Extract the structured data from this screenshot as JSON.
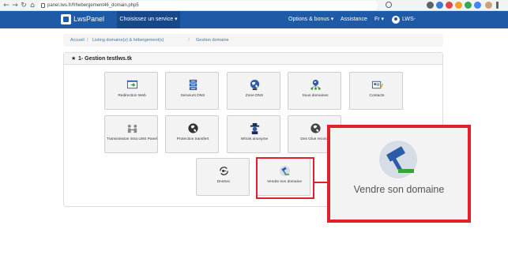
{
  "browser": {
    "url": "panel.lws.fr/frhebergement46_domain.php5",
    "back_glyph": "←",
    "forward_glyph": "→",
    "reload_glyph": "↻",
    "home_glyph": "⌂"
  },
  "navbar": {
    "brand": "LwsPanel",
    "services_label": "Choisissez un service ▾",
    "options_label": "Options & bonus ▾",
    "assistance_label": "Assistance",
    "language_label": "Fr ▾",
    "user_label": "LWS-",
    "colors": {
      "bar": "#1f5aa6",
      "active": "#17488a"
    }
  },
  "breadcrumb": {
    "home": "Accueil",
    "listing": "Listing domaine(s) & hébergement(s)",
    "current": "Gestion domaine",
    "separator": "/"
  },
  "panel": {
    "star_glyph": "★",
    "title": "1- Gestion testlws.tk"
  },
  "tiles": [
    {
      "label": "Redirection Web",
      "icon": "redirect-icon"
    },
    {
      "label": "Serveurs DNS",
      "icon": "server-icon"
    },
    {
      "label": "Zone DNS",
      "icon": "globe-icon"
    },
    {
      "label": "Sous domaines",
      "icon": "subdomain-globe-icon"
    },
    {
      "label": "Contacts",
      "icon": "contacts-icon"
    },
    {
      "label": "Transmission intra LWS Panel",
      "icon": "transfer-people-icon"
    },
    {
      "label": "Protection transfert",
      "icon": "globe-shield-icon"
    },
    {
      "label": "Whois anonyme",
      "icon": "anonymous-icon"
    },
    {
      "label": "Dns Glue records",
      "icon": "globe-glue-icon"
    },
    {
      "label": "DnsSec",
      "icon": "key-refresh-icon"
    },
    {
      "label": "Vendre son domaine",
      "icon": "gavel-icon"
    }
  ],
  "callout": {
    "label": "Vendre son domaine",
    "highlight_color": "#e0202a"
  }
}
